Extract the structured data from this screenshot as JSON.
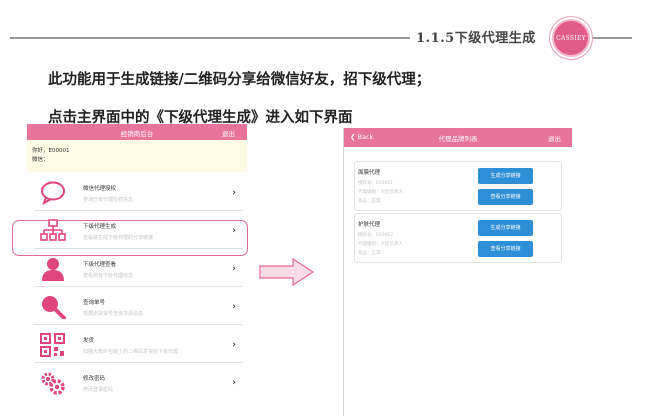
{
  "header": {
    "section_title": "1.1.5下级代理生成",
    "logo_text": "CASSIEY",
    "line1": "此功能用于生成链接/二维码分享给微信好友，招下级代理；",
    "line2": "点击主界面中的《下级代理生成》进入如下界面"
  },
  "left_screen": {
    "title": "经销商后台",
    "exit": "退出",
    "greeting": "你好，E00001",
    "wechat": "微信：",
    "menu": [
      {
        "title": "微信代理授权",
        "desc": "查询已有代理授权信息"
      },
      {
        "title": "下级代理生成",
        "desc": "查看或生成下级代理的分享链接"
      },
      {
        "title": "下级代理查看",
        "desc": "查看所有下级代理信息"
      },
      {
        "title": "查询单号",
        "desc": "根据出货单号查询货源信息"
      },
      {
        "title": "发货",
        "desc": "扫描大箱外包装上的二维码发货给下级代理"
      },
      {
        "title": "修改密码",
        "desc": "修改登录密码"
      }
    ]
  },
  "right_screen": {
    "back": "Back",
    "title": "代理品牌列表",
    "exit": "退出",
    "cards": [
      {
        "name": "面膜代理",
        "line1": "授权号：E00001",
        "line2": "代理级别：大区负责人",
        "line3": "状态：正常",
        "btn1": "生成分享链接",
        "btn2": "查看分享链接"
      },
      {
        "name": "护肤代理",
        "line1": "授权号：E00002",
        "line2": "代理级别：大区负责人",
        "line3": "状态：正常",
        "btn1": "生成分享链接",
        "btn2": "查看分享链接"
      }
    ]
  },
  "colors": {
    "accent_pink": "#e8739b",
    "button_blue": "#2f8fd6",
    "icon_pink": "#e0457e"
  }
}
